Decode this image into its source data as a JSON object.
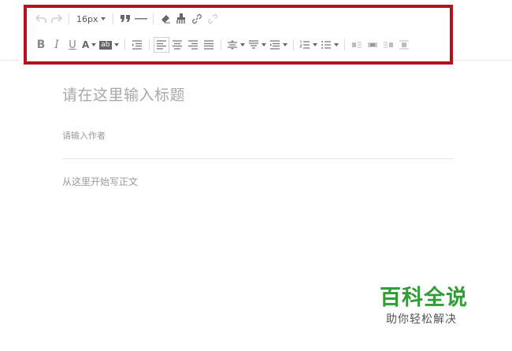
{
  "toolbar": {
    "font_size": "16px",
    "row1_icons": [
      "undo-icon",
      "redo-icon",
      "quote-icon",
      "horizontal-rule-icon",
      "eraser-icon",
      "format-brush-icon",
      "link-icon",
      "unlink-icon"
    ],
    "row2_icons": [
      "bold-icon",
      "italic-icon",
      "underline-icon",
      "font-color-icon",
      "background-color-icon",
      "indent-icon",
      "align-left-icon",
      "align-center-icon",
      "align-right-icon",
      "align-justify-icon",
      "line-height-icon",
      "paragraph-spacing-icon",
      "heading-icon",
      "ordered-list-icon",
      "unordered-list-icon",
      "float-left-icon",
      "float-center-icon",
      "float-right-icon",
      "float-none-icon"
    ],
    "bold_label": "B",
    "italic_label": "I",
    "underline_label": "U",
    "font_color_label": "A",
    "bg_color_label": "ab",
    "border_color": "#b5101c"
  },
  "editor": {
    "title_placeholder": "请在这里输入标题",
    "author_placeholder": "请输入作者",
    "body_placeholder": "从这里开始写正文"
  },
  "watermark": {
    "title": "百科全说",
    "subtitle": "助你轻松解决",
    "title_color": "#2f9e35"
  }
}
